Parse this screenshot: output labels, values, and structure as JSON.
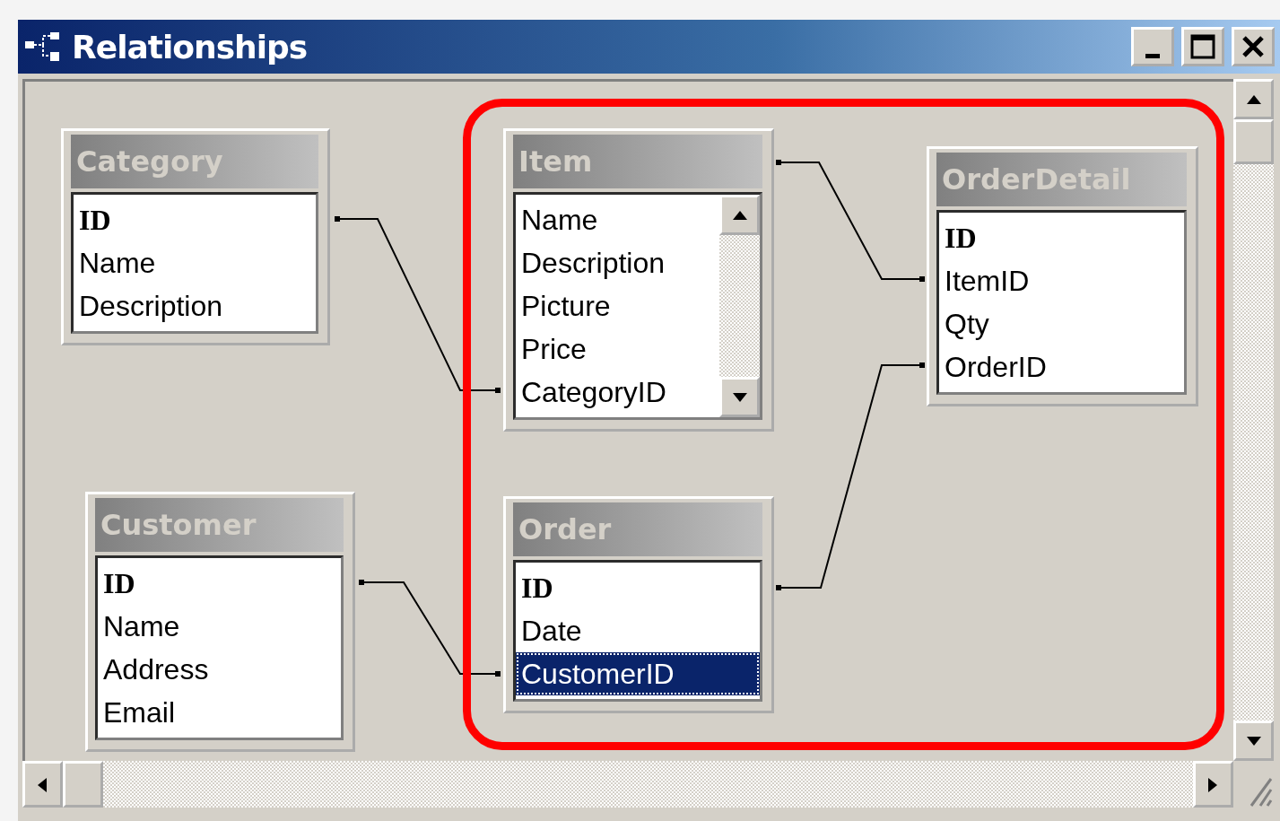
{
  "window": {
    "title": "Relationships"
  },
  "tables": [
    {
      "name": "Category",
      "kind": "plain",
      "fields": [
        {
          "name": "ID",
          "primary_key": true,
          "selected": false
        },
        {
          "name": "Name",
          "primary_key": false,
          "selected": false
        },
        {
          "name": "Description",
          "primary_key": false,
          "selected": false
        }
      ]
    },
    {
      "name": "Item",
      "kind": "scrolling",
      "fields": [
        {
          "name": "Name",
          "primary_key": false,
          "selected": false
        },
        {
          "name": "Description",
          "primary_key": false,
          "selected": false
        },
        {
          "name": "Picture",
          "primary_key": false,
          "selected": false
        },
        {
          "name": "Price",
          "primary_key": false,
          "selected": false
        },
        {
          "name": "CategoryID",
          "primary_key": false,
          "selected": false
        }
      ]
    },
    {
      "name": "OrderDetail",
      "kind": "plain",
      "fields": [
        {
          "name": "ID",
          "primary_key": true,
          "selected": false
        },
        {
          "name": "ItemID",
          "primary_key": false,
          "selected": false
        },
        {
          "name": "Qty",
          "primary_key": false,
          "selected": false
        },
        {
          "name": "OrderID",
          "primary_key": false,
          "selected": false
        }
      ]
    },
    {
      "name": "Customer",
      "kind": "plain",
      "fields": [
        {
          "name": "ID",
          "primary_key": true,
          "selected": false
        },
        {
          "name": "Name",
          "primary_key": false,
          "selected": false
        },
        {
          "name": "Address",
          "primary_key": false,
          "selected": false
        },
        {
          "name": "Email",
          "primary_key": false,
          "selected": false
        }
      ]
    },
    {
      "name": "Order",
      "kind": "plain",
      "fields": [
        {
          "name": "ID",
          "primary_key": true,
          "selected": false
        },
        {
          "name": "Date",
          "primary_key": false,
          "selected": false
        },
        {
          "name": "CustomerID",
          "primary_key": false,
          "selected": true
        }
      ]
    }
  ]
}
